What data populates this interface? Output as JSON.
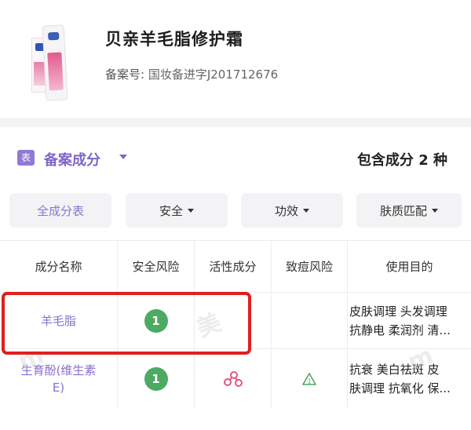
{
  "product": {
    "name": "贝亲羊毛脂修护霜",
    "registration_label": "备案号:",
    "registration_value": "国妆备进字J201712676"
  },
  "section": {
    "icon_text": "表",
    "title": "备案成分",
    "count_text": "包含成分 2 种"
  },
  "filters": [
    {
      "label": "全成分表",
      "active": true
    },
    {
      "label": "安全",
      "active": false
    },
    {
      "label": "功效",
      "active": false
    },
    {
      "label": "肤质匹配",
      "active": false
    }
  ],
  "table": {
    "headers": [
      "成分名称",
      "安全风险",
      "活性成分",
      "致痘风险",
      "使用目的"
    ],
    "rows": [
      {
        "name": "羊毛脂",
        "safety": "1",
        "active": false,
        "acne_risk": false,
        "purpose_line1": "皮肤调理 头发调理",
        "purpose_line2": "抗静电 柔润剂 清..."
      },
      {
        "name_line1": "生育酚(维生素",
        "name_line2": "E)",
        "safety": "1",
        "active": true,
        "acne_risk": true,
        "purpose_line1": "抗衰 美白祛斑 皮",
        "purpose_line2": "肤调理 抗氧化 保..."
      }
    ]
  },
  "colors": {
    "accent": "#7d66c9",
    "safe_green": "#4caa63",
    "highlight_red": "#e01f1f",
    "active_pink": "#e2577f"
  }
}
